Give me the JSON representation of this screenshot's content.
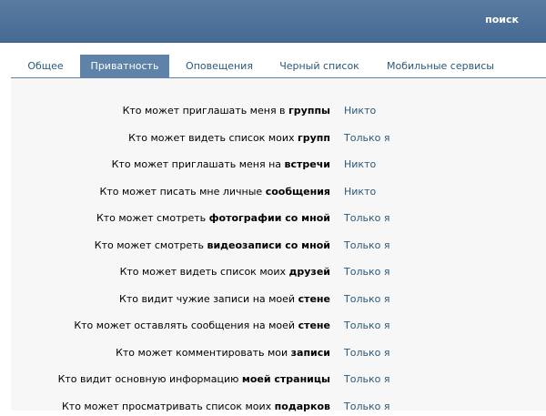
{
  "header": {
    "search_label": "поиск"
  },
  "tabs": [
    {
      "label": "Общее",
      "active": false
    },
    {
      "label": "Приватность",
      "active": true
    },
    {
      "label": "Оповещения",
      "active": false
    },
    {
      "label": "Черный список",
      "active": false
    },
    {
      "label": "Мобильные сервисы",
      "active": false
    }
  ],
  "settings": [
    {
      "prefix": "Кто может приглашать меня в ",
      "bold": "группы",
      "value": "Никто"
    },
    {
      "prefix": "Кто может видеть список моих ",
      "bold": "групп",
      "value": "Только я"
    },
    {
      "prefix": "Кто может приглашать меня на ",
      "bold": "встречи",
      "value": "Никто"
    },
    {
      "prefix": "Кто может писать мне личные ",
      "bold": "сообщения",
      "value": "Никто"
    },
    {
      "prefix": "Кто может смотреть ",
      "bold": "фотографии со мной",
      "value": "Только я"
    },
    {
      "prefix": "Кто может смотреть ",
      "bold": "видеозаписи со мной",
      "value": "Только я"
    },
    {
      "prefix": "Кто может видеть список моих ",
      "bold": "друзей",
      "value": "Только я"
    },
    {
      "prefix": "Кто видит чужие записи на моей ",
      "bold": "стене",
      "value": "Только я"
    },
    {
      "prefix": "Кто может оставлять сообщения на моей ",
      "bold": "стене",
      "value": "Только я"
    },
    {
      "prefix": "Кто может комментировать мои ",
      "bold": "записи",
      "value": "Только я"
    },
    {
      "prefix": "Кто видит основную информацию ",
      "bold": "моей страницы",
      "value": "Только я"
    },
    {
      "prefix": "Кто может просматривать список моих ",
      "bold": "подарков",
      "value": "Только я"
    }
  ]
}
